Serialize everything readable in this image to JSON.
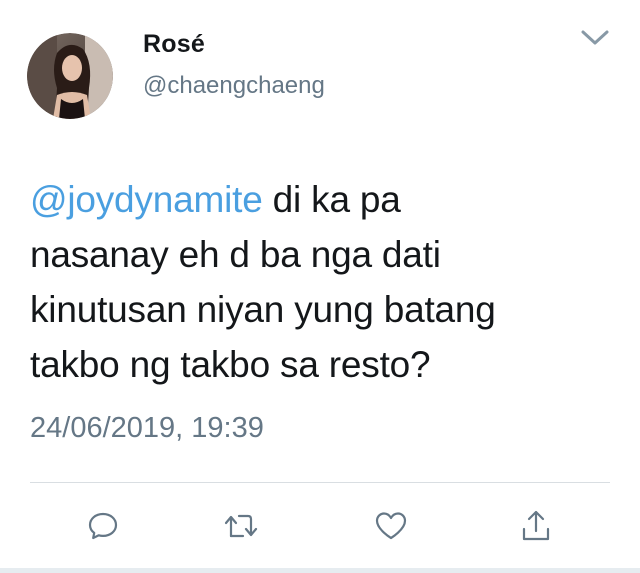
{
  "author": {
    "display_name": "Rosé",
    "handle": "@chaengchaeng",
    "avatar_icon": "profile-photo"
  },
  "tweet": {
    "mention": "@joydynamite",
    "line1_rest": " di ka pa",
    "line2": "nasanay eh d ba nga dati",
    "line3": "kinutusan niyan yung batang",
    "line4": "takbo ng takbo sa resto?",
    "timestamp": "24/06/2019, 19:39"
  },
  "actions": {
    "reply_icon": "comment-icon",
    "retweet_icon": "retweet-icon",
    "like_icon": "heart-icon",
    "share_icon": "share-icon"
  },
  "colors": {
    "link": "#4a9fe0",
    "text": "#14171a",
    "secondary": "#657786",
    "icon": "#657786"
  }
}
